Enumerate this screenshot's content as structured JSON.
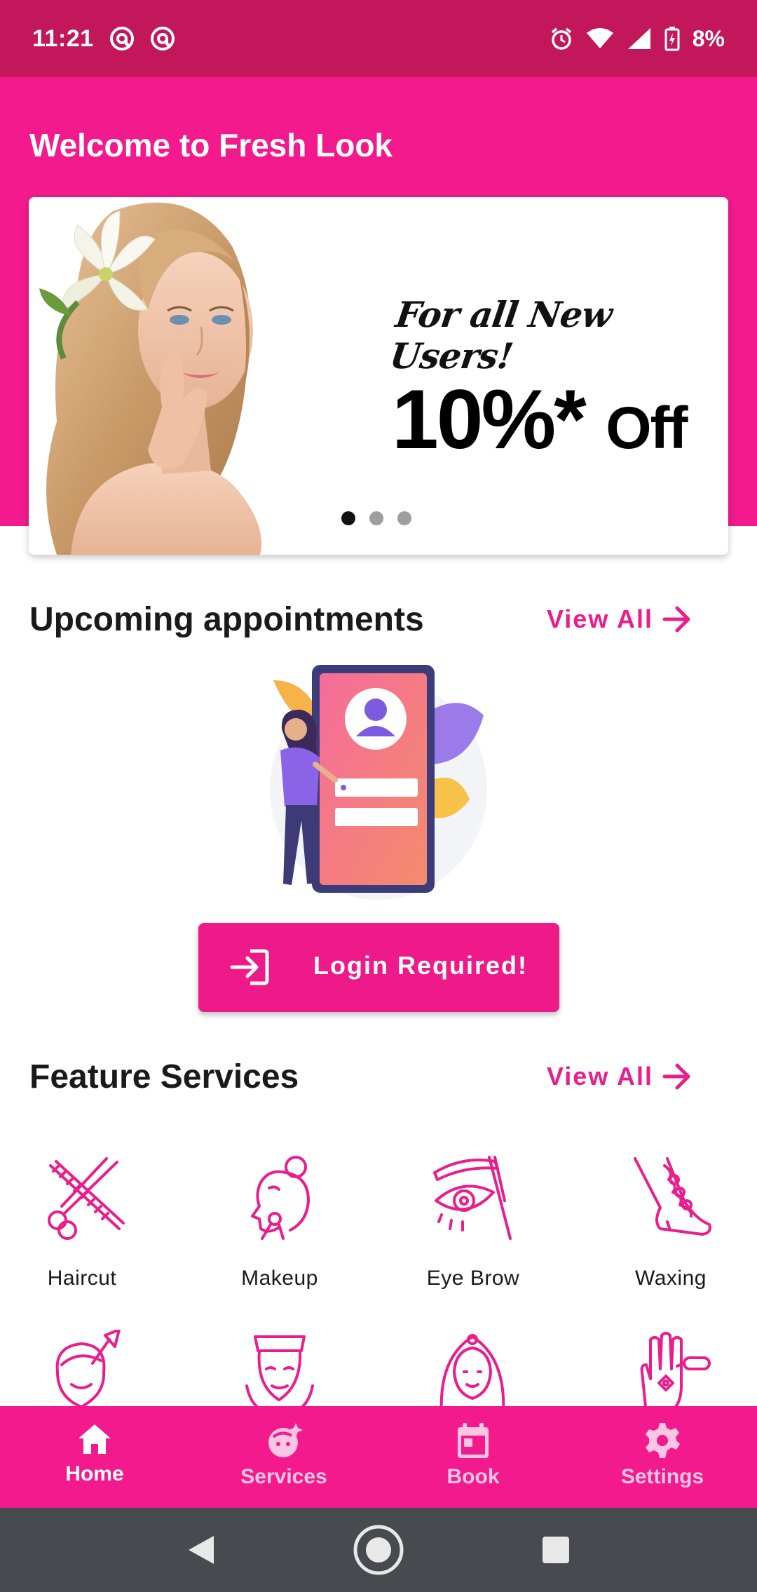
{
  "status_bar": {
    "time": "11:21",
    "battery": "8%",
    "icons": [
      "notification-icon",
      "notification-icon",
      "alarm-icon",
      "wifi-icon",
      "signal-icon",
      "battery-icon"
    ]
  },
  "hero": {
    "welcome": "Welcome to Fresh Look",
    "banner": {
      "line1": "For all New Users!",
      "discount": "10%*",
      "off": "Off",
      "slide_count": 3,
      "active_slide": 1
    }
  },
  "appointments": {
    "title": "Upcoming appointments",
    "view_all": "View All",
    "login_button": "Login Required!"
  },
  "features": {
    "title": "Feature Services",
    "view_all": "View All",
    "items": [
      {
        "name": "Haircut",
        "icon": "scissors-comb-icon"
      },
      {
        "name": "Makeup",
        "icon": "makeup-face-icon"
      },
      {
        "name": "Eye Brow",
        "icon": "eyebrow-icon"
      },
      {
        "name": "Waxing",
        "icon": "waxing-leg-icon"
      },
      {
        "name": "",
        "icon": "hair-color-icon"
      },
      {
        "name": "",
        "icon": "facial-icon"
      },
      {
        "name": "",
        "icon": "bridal-icon"
      },
      {
        "name": "",
        "icon": "mehndi-hand-icon"
      }
    ]
  },
  "bottom_nav": {
    "items": [
      {
        "label": "Home",
        "icon": "home-icon",
        "active": true
      },
      {
        "label": "Services",
        "icon": "services-face-icon",
        "active": false
      },
      {
        "label": "Book",
        "icon": "calendar-icon",
        "active": false
      },
      {
        "label": "Settings",
        "icon": "gear-icon",
        "active": false
      }
    ]
  },
  "colors": {
    "brand": "#f21a8c",
    "status_bar": "#c2185b",
    "accent_text": "#e91e8c",
    "system_nav": "#474a4f"
  }
}
